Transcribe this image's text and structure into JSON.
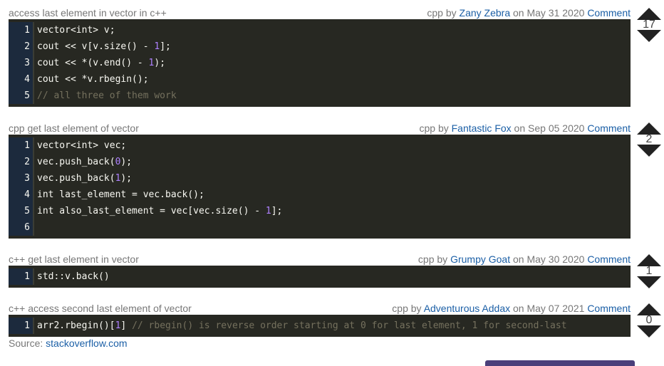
{
  "snippets": [
    {
      "title": "access last element in vector in c++",
      "lang": "cpp",
      "by": "by",
      "author": "Zany Zebra",
      "on": "on",
      "date": "May 31 2020",
      "comment_label": "Comment",
      "votes": "17",
      "lines": [
        [
          {
            "t": "vector<int> v;"
          }
        ],
        [
          {
            "t": "cout << v[v.size() - "
          },
          {
            "t": "1",
            "c": "num"
          },
          {
            "t": "];"
          }
        ],
        [
          {
            "t": "cout << *(v.end() - "
          },
          {
            "t": "1",
            "c": "num"
          },
          {
            "t": ");"
          }
        ],
        [
          {
            "t": "cout << *v.rbegin();"
          }
        ],
        [
          {
            "t": "// all three of them work",
            "c": "cmt"
          }
        ]
      ]
    },
    {
      "title": "cpp get last element of vector",
      "lang": "cpp",
      "by": "by",
      "author": "Fantastic Fox",
      "on": "on",
      "date": "Sep 05 2020",
      "comment_label": "Comment",
      "votes": "2",
      "lines": [
        [
          {
            "t": "vector<int> vec;"
          }
        ],
        [
          {
            "t": "vec.push_back("
          },
          {
            "t": "0",
            "c": "num"
          },
          {
            "t": ");"
          }
        ],
        [
          {
            "t": "vec.push_back("
          },
          {
            "t": "1",
            "c": "num"
          },
          {
            "t": ");"
          }
        ],
        [
          {
            "t": "int last_element = vec.back();"
          }
        ],
        [
          {
            "t": "int also_last_element = vec[vec.size() - "
          },
          {
            "t": "1",
            "c": "num"
          },
          {
            "t": "];"
          }
        ],
        [
          {
            "t": ""
          }
        ]
      ]
    },
    {
      "title": "c++ get last element in vector",
      "lang": "cpp",
      "by": "by",
      "author": "Grumpy Goat",
      "on": "on",
      "date": "May 30 2020",
      "comment_label": "Comment",
      "votes": "1",
      "lines": [
        [
          {
            "t": "std::v.back()"
          }
        ]
      ]
    },
    {
      "title": "c++ access second last element of vector",
      "lang": "cpp",
      "by": "by",
      "author": "Adventurous Addax",
      "on": "on",
      "date": "May 07 2021",
      "comment_label": "Comment",
      "votes": "0",
      "lines": [
        [
          {
            "t": "arr2.rbegin()["
          },
          {
            "t": "1",
            "c": "num"
          },
          {
            "t": "] "
          },
          {
            "t": "// rbegin() is reverse order starting at 0 for last element, 1 for second-last",
            "c": "cmt"
          }
        ]
      ]
    }
  ],
  "source": {
    "label": "Source:",
    "link": "stackoverflow.com"
  }
}
